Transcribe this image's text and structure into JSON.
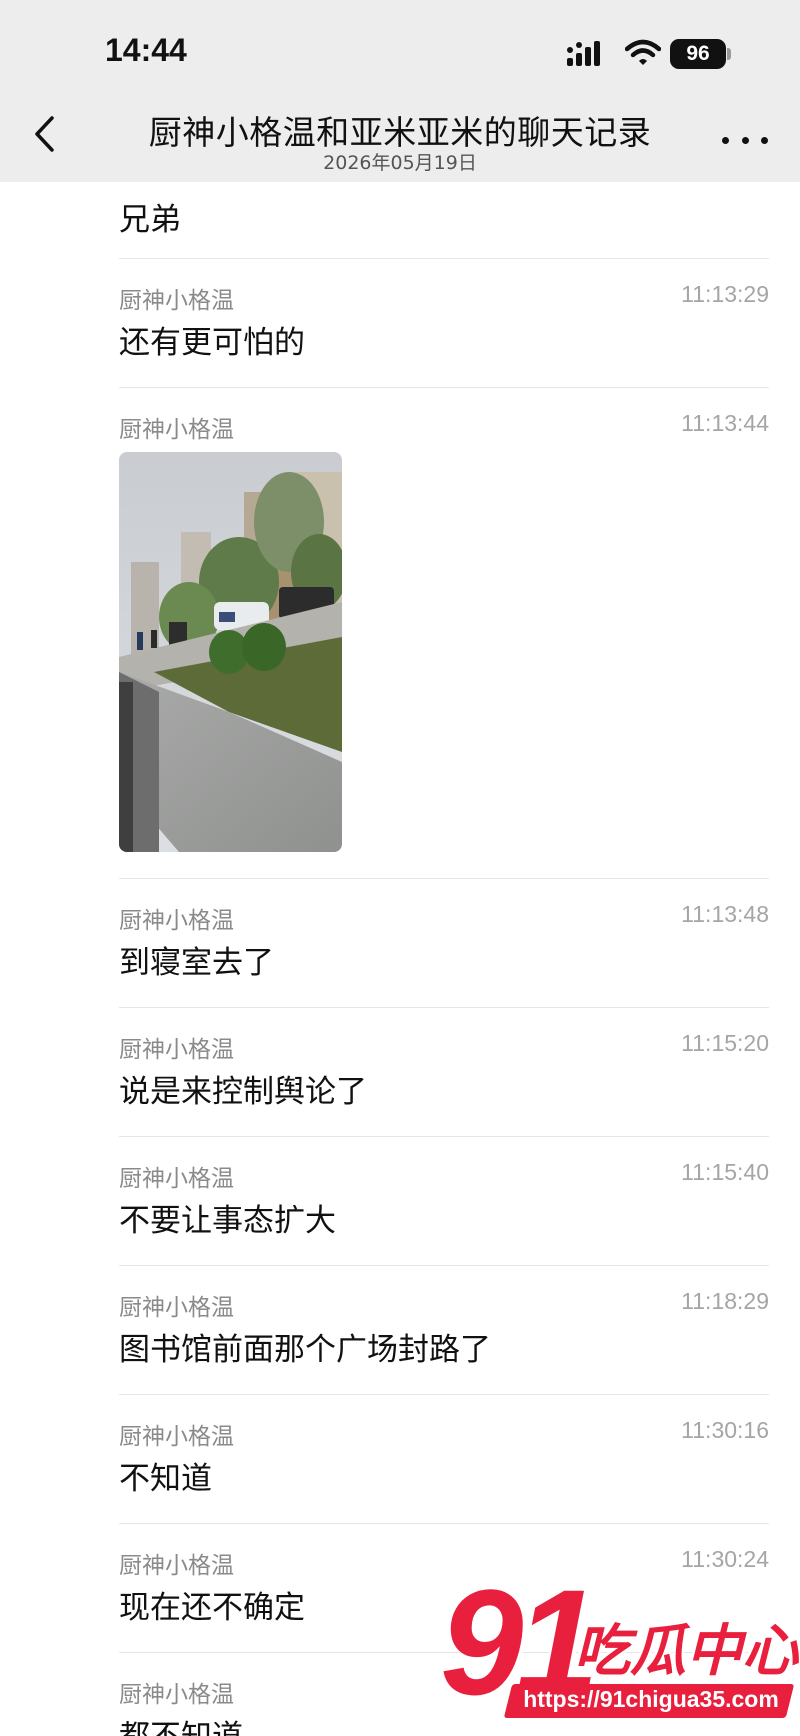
{
  "status_bar": {
    "time": "14:44",
    "battery": "96"
  },
  "nav": {
    "title": "厨神小格温和亚米亚米的聊天记录",
    "date": "2026年05月19日"
  },
  "messages": [
    {
      "text": "兄弟"
    },
    {
      "sender": "厨神小格温",
      "time": "11:13:29",
      "text": "还有更可怕的"
    },
    {
      "sender": "厨神小格温",
      "time": "11:13:44",
      "image": "street-photo"
    },
    {
      "sender": "厨神小格温",
      "time": "11:13:48",
      "text": "到寝室去了"
    },
    {
      "sender": "厨神小格温",
      "time": "11:15:20",
      "text": "说是来控制舆论了"
    },
    {
      "sender": "厨神小格温",
      "time": "11:15:40",
      "text": "不要让事态扩大"
    },
    {
      "sender": "厨神小格温",
      "time": "11:18:29",
      "text": "图书馆前面那个广场封路了"
    },
    {
      "sender": "厨神小格温",
      "time": "11:30:16",
      "text": "不知道"
    },
    {
      "sender": "厨神小格温",
      "time": "11:30:24",
      "text": "现在还不确定"
    },
    {
      "sender": "厨神小格温",
      "text": "都不知道"
    }
  ],
  "watermark": {
    "number": "91",
    "brand": "吃瓜中心",
    "url": "https://91chigua35.com"
  },
  "colors": {
    "header_bg": "#ededed",
    "watermark_red": "#e8203d"
  }
}
